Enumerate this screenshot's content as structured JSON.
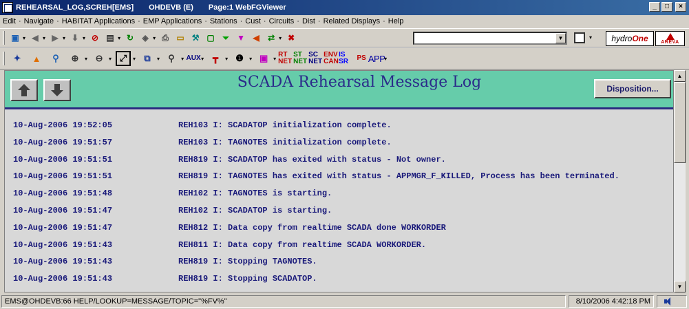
{
  "window": {
    "title": "REHEARSAL_LOG,SCREH[EMS]",
    "host": "OHDEVB (E)",
    "page": "Page:1 WebFGViewer",
    "minimize": "_",
    "maximize": "□",
    "close": "×"
  },
  "menu": {
    "items": [
      "Edit",
      "Navigate",
      "HABITAT Applications",
      "EMP Applications",
      "Stations",
      "Cust",
      "Circuits",
      "Dist",
      "Related Displays",
      "Help"
    ],
    "separator": "·"
  },
  "toolbar": {
    "combo_value": "",
    "logo_hydro_a": "hydro",
    "logo_hydro_b": "One",
    "logo_areva": "AREVA",
    "badges": {
      "aux": "AUX",
      "rt_net": "RT NET",
      "st_net": "ST NET",
      "sc_net": "SC NET",
      "env_can": "ENV CAN",
      "is_sr": "IS SR",
      "ps": "PS",
      "app": "APP"
    }
  },
  "banner": {
    "title": "SCADA Rehearsal Message Log",
    "disposition_label": "Disposition..."
  },
  "log": [
    {
      "ts": "10-Aug-2006 19:52:05",
      "msg": "REH103 I: SCADATOP initialization complete."
    },
    {
      "ts": "10-Aug-2006 19:51:57",
      "msg": "REH103 I: TAGNOTES initialization complete."
    },
    {
      "ts": "10-Aug-2006 19:51:51",
      "msg": "REH819 I: SCADATOP has exited with status - Not owner."
    },
    {
      "ts": "10-Aug-2006 19:51:51",
      "msg": "REH819 I: TAGNOTES has exited with status - APPMGR_F_KILLED, Process has been terminated."
    },
    {
      "ts": "10-Aug-2006 19:51:48",
      "msg": "REH102 I: TAGNOTES is starting."
    },
    {
      "ts": "10-Aug-2006 19:51:47",
      "msg": "REH102 I: SCADATOP is starting."
    },
    {
      "ts": "10-Aug-2006 19:51:47",
      "msg": "REH812 I: Data copy from realtime SCADA done WORKORDER"
    },
    {
      "ts": "10-Aug-2006 19:51:43",
      "msg": "REH811 I: Data copy from realtime SCADA WORKORDER."
    },
    {
      "ts": "10-Aug-2006 19:51:43",
      "msg": "REH819 I: Stopping TAGNOTES."
    },
    {
      "ts": "10-Aug-2006 19:51:43",
      "msg": "REH819 I: Stopping SCADATOP."
    }
  ],
  "status": {
    "main": "EMS@OHDEVB:66   HELP/LOOKUP=MESSAGE/TOPIC=\"%FV%\"",
    "time": "8/10/2006 4:42:18 PM"
  }
}
